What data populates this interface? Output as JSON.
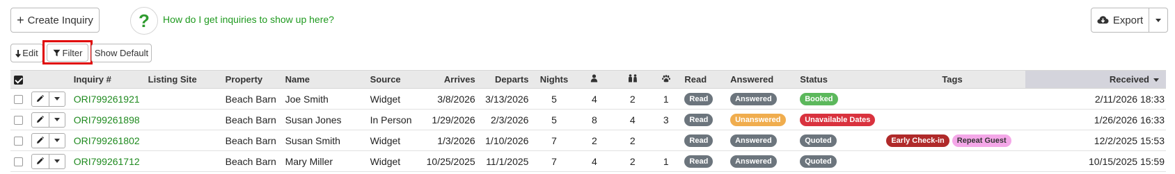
{
  "toolbar": {
    "create_label": "Create Inquiry",
    "help_text": "How do I get inquiries to show up here?",
    "help_symbol": "?",
    "export_label": "Export",
    "edit_label": "Edit",
    "filter_label": "Filter",
    "show_default_label": "Show Default"
  },
  "table": {
    "headers": {
      "inquiry": "Inquiry #",
      "listing_site": "Listing Site",
      "property": "Property",
      "name": "Name",
      "source": "Source",
      "arrives": "Arrives",
      "departs": "Departs",
      "nights": "Nights",
      "read": "Read",
      "answered": "Answered",
      "status": "Status",
      "tags": "Tags",
      "received": "Received"
    },
    "header_icons": {
      "adults": "person-icon",
      "children": "children-icon",
      "pets": "paw-icon"
    },
    "rows": [
      {
        "inquiry": "ORI799261921",
        "listing_site": "",
        "property": "Beach Barn",
        "name": "Joe Smith",
        "source": "Widget",
        "arrives": "3/8/2026",
        "departs": "3/13/2026",
        "nights": "5",
        "adults": "4",
        "children": "2",
        "pets": "1",
        "read": "Read",
        "answered": "Answered",
        "answered_color": "#6c757d",
        "status": "Booked",
        "status_color": "#5cb85c",
        "tags": [],
        "received": "2/11/2026 18:33"
      },
      {
        "inquiry": "ORI799261898",
        "listing_site": "",
        "property": "Beach Barn",
        "name": "Susan Jones",
        "source": "In Person",
        "arrives": "1/29/2026",
        "departs": "2/3/2026",
        "nights": "5",
        "adults": "8",
        "children": "4",
        "pets": "3",
        "read": "Read",
        "answered": "Unanswered",
        "answered_color": "#f0ad4e",
        "status": "Unavailable Dates",
        "status_color": "#d9323e",
        "tags": [],
        "received": "1/26/2026 16:33"
      },
      {
        "inquiry": "ORI799261802",
        "listing_site": "",
        "property": "Beach Barn",
        "name": "Susan Smith",
        "source": "Widget",
        "arrives": "1/3/2026",
        "departs": "1/10/2026",
        "nights": "7",
        "adults": "2",
        "children": "2",
        "pets": "",
        "read": "Read",
        "answered": "Answered",
        "answered_color": "#6c757d",
        "status": "Quoted",
        "status_color": "#6c757d",
        "tags": [
          {
            "label": "Early Check-in",
            "color": "#b02a2a"
          },
          {
            "label": "Repeat Guest",
            "color": "#f4a7e8"
          }
        ],
        "received": "12/2/2025 15:53"
      },
      {
        "inquiry": "ORI799261712",
        "listing_site": "",
        "property": "Beach Barn",
        "name": "Mary Miller",
        "source": "Widget",
        "arrives": "10/25/2025",
        "departs": "11/1/2025",
        "nights": "7",
        "adults": "4",
        "children": "2",
        "pets": "1",
        "read": "Read",
        "answered": "Answered",
        "answered_color": "#6c757d",
        "status": "Quoted",
        "status_color": "#6c757d",
        "tags": [],
        "received": "10/15/2025 15:59"
      }
    ]
  }
}
